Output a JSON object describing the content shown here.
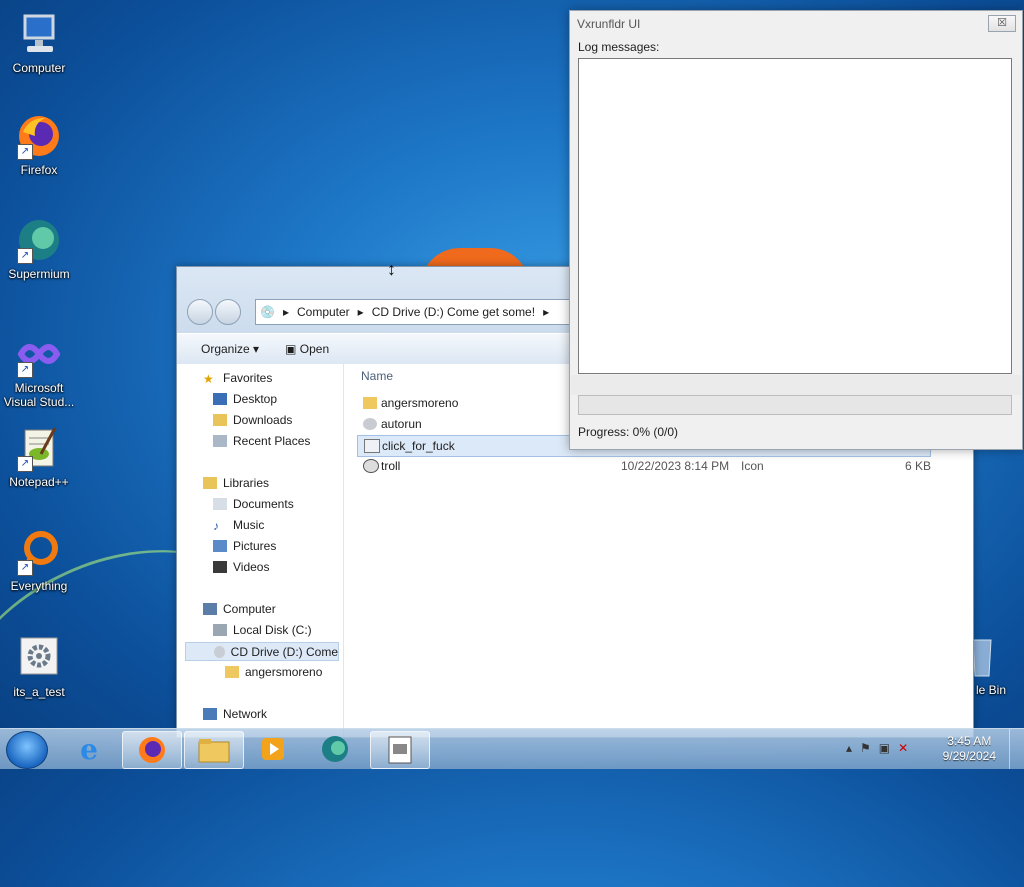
{
  "desktop": {
    "icons": [
      {
        "label": "Computer",
        "icon": "computer-icon"
      },
      {
        "label": "Firefox",
        "icon": "firefox-icon"
      },
      {
        "label": "Supermium",
        "icon": "supermium-icon"
      },
      {
        "label": "Microsoft Visual Stud...",
        "icon": "visual-studio-icon"
      },
      {
        "label": "Notepad++",
        "icon": "notepad-plus-plus-icon"
      },
      {
        "label": "Everything",
        "icon": "everything-search-icon"
      },
      {
        "label": "its_a_test",
        "icon": "settings-gear-icon"
      }
    ],
    "recycle_bin_label": "le Bin"
  },
  "explorer": {
    "breadcrumb": [
      "Computer",
      "CD Drive (D:) Come get some!"
    ],
    "toolbar": {
      "organize": "Organize",
      "open": "Open"
    },
    "nav": {
      "favorites": "Favorites",
      "desktop": "Desktop",
      "downloads": "Downloads",
      "recent": "Recent Places",
      "libraries": "Libraries",
      "documents": "Documents",
      "music": "Music",
      "pictures": "Pictures",
      "videos": "Videos",
      "computer": "Computer",
      "local_disk": "Local Disk (C:)",
      "cd_drive": "CD Drive (D:) Come",
      "folder": "angersmoreno",
      "network": "Network"
    },
    "columns": {
      "name": "Name"
    },
    "files": [
      {
        "name": "angersmoreno",
        "date": "",
        "type": "",
        "size": ""
      },
      {
        "name": "autorun",
        "date": "",
        "type": "",
        "size": ""
      },
      {
        "name": "click_for_fuck",
        "date": "",
        "type": "",
        "size": ""
      },
      {
        "name": "troll",
        "date": "10/22/2023 8:14 PM",
        "type": "Icon",
        "size": "6 KB"
      }
    ]
  },
  "vx": {
    "title": "Vxrunfldr UI",
    "close": "☒",
    "log_label": "Log messages:",
    "progress_text": "Progress: 0% (0/0)",
    "progress_value": 0
  },
  "taskbar": {
    "time": "3:45 AM",
    "date": "9/29/2024"
  }
}
